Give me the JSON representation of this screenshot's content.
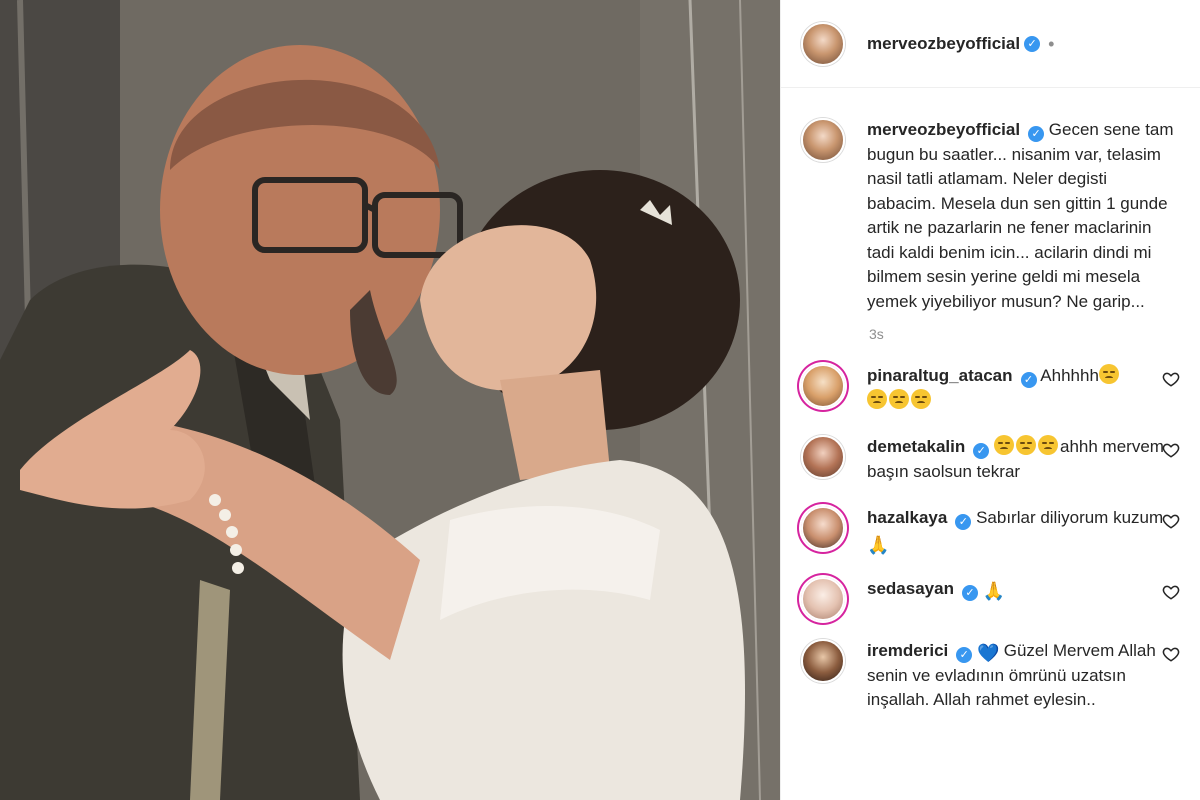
{
  "post": {
    "author": "merveozbeyofficial",
    "verified_mark": "✓",
    "header_separator": "•",
    "caption": "Gecen sene tam bugun bu saatler... nisanim var, telasim nasil tatli atlamam. Neler degisti babacim. Mesela dun sen gittin 1 gunde artik ne pazarlarin ne fener maclarinin tadi kaldi benim icin... acilarin dindi mi bilmem sesin yerine geldi mi mesela yemek yiyebiliyor musun? Ne garip...",
    "timestamp": "3s"
  },
  "comments": [
    {
      "username": "pinaraltug_atacan",
      "text_before": "Ahhhhh",
      "emojis_before": 1,
      "emojis_after": 3,
      "text_after": ""
    },
    {
      "username": "demetakalin",
      "text_before": "",
      "emojis_before": 3,
      "text_after": "ahhh mervem başın saolsun tekrar"
    },
    {
      "username": "hazalkaya",
      "text_before": "Sabırlar diliyorum kuzum",
      "trailing_emoji": "🙏"
    },
    {
      "username": "sedasayan",
      "text_before": "",
      "trailing_emoji": "🙏"
    },
    {
      "username": "iremderici",
      "leading_emoji": "💙",
      "text_before": "Güzel Mervem Allah senin ve evladının ömrünü uzatsın inşallah. Allah rahmet eylesin.."
    }
  ],
  "icons": {
    "verified": "verified-badge-icon",
    "like": "heart-icon",
    "sad_emoji": "pensive-face-emoji",
    "prayer_emoji": "folded-hands-emoji",
    "blue_heart_emoji": "blue-heart-emoji"
  },
  "colors": {
    "verified_blue": "#3897f0",
    "story_ring": "#d6249f",
    "muted_text": "#8e8e8e",
    "primary_text": "#262626"
  }
}
